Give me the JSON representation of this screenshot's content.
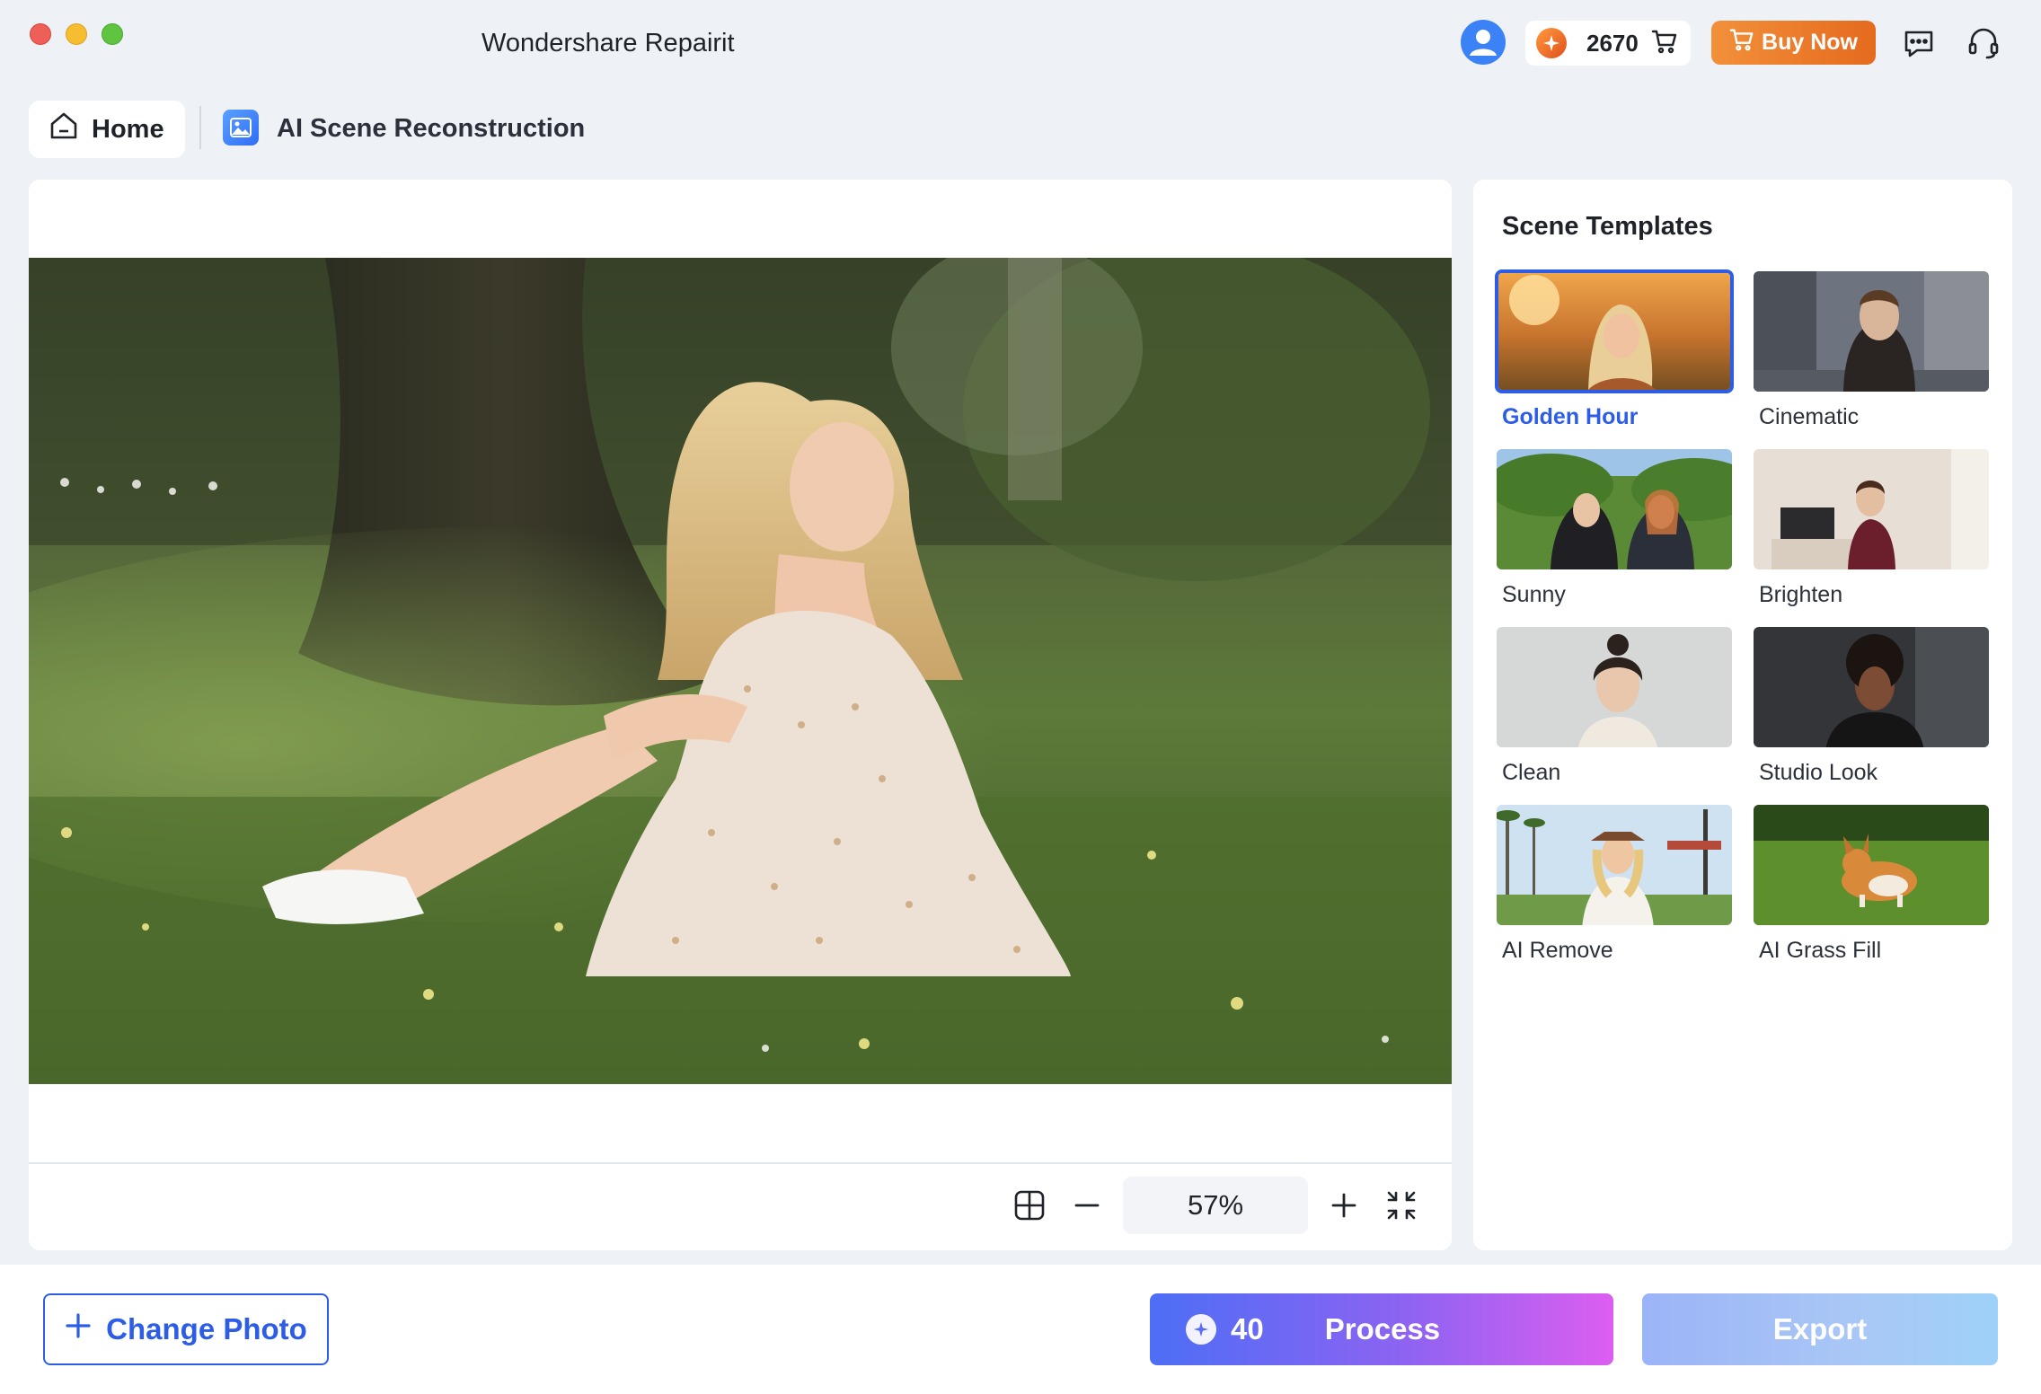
{
  "window": {
    "title": "Wondershare Repairit"
  },
  "header": {
    "credits": "2670",
    "buy_label": "Buy Now",
    "icons": [
      "user-avatar-icon",
      "credit-coin-icon",
      "cart-icon",
      "chat-icon",
      "headset-support-icon"
    ]
  },
  "breadcrumb": {
    "home_label": "Home",
    "current_label": "AI Scene Reconstruction"
  },
  "canvas": {
    "zoom": "57%"
  },
  "templates_panel": {
    "title": "Scene Templates",
    "selected": "Golden Hour",
    "items": [
      {
        "label": "Golden Hour"
      },
      {
        "label": "Cinematic"
      },
      {
        "label": "Sunny"
      },
      {
        "label": "Brighten"
      },
      {
        "label": "Clean"
      },
      {
        "label": "Studio Look"
      },
      {
        "label": "AI Remove"
      },
      {
        "label": "AI Grass Fill"
      }
    ]
  },
  "footer": {
    "change_photo_label": "Change Photo",
    "process_cost": "40",
    "process_label": "Process",
    "export_label": "Export"
  },
  "colors": {
    "accent": "#2d5de6",
    "buy": "#e9761f",
    "background": "#eef1f6"
  }
}
